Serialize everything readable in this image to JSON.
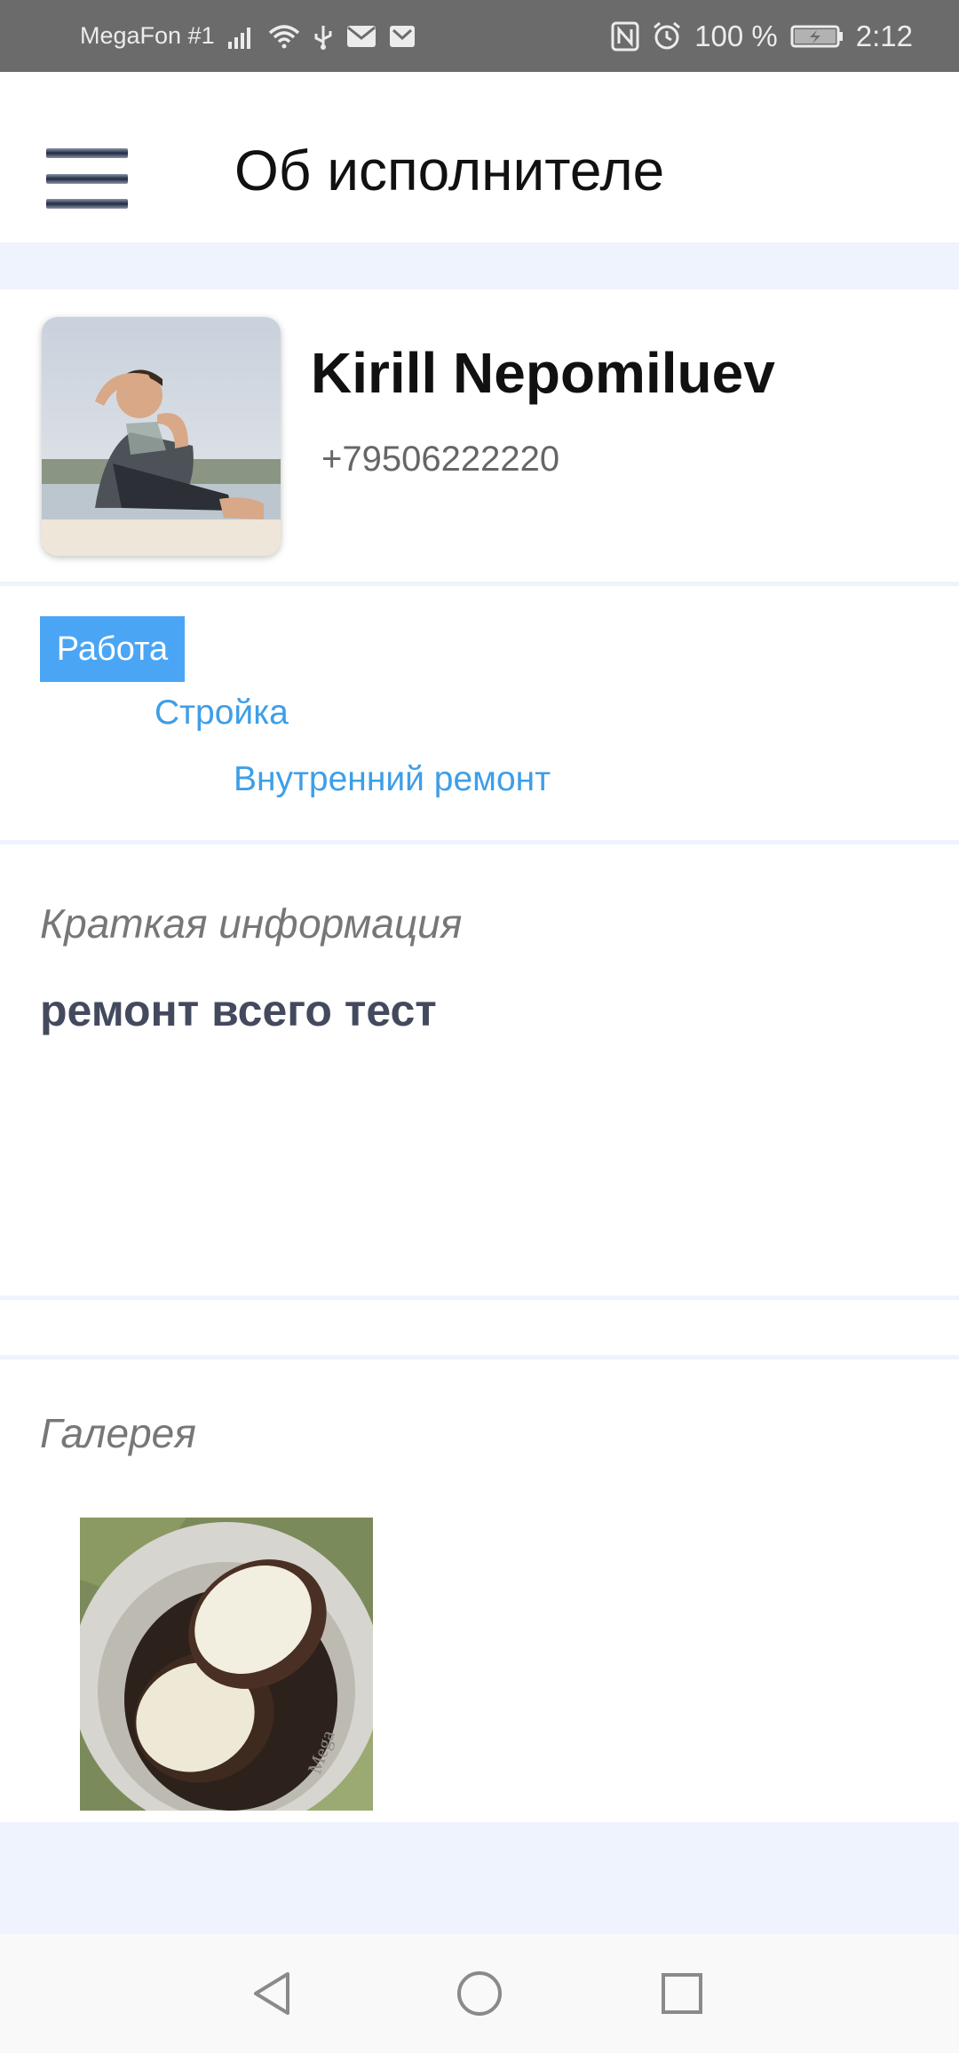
{
  "status_bar": {
    "carrier": "MegaFon #1",
    "battery_percent": "100 %",
    "time": "2:12",
    "icons": [
      "signal-icon",
      "wifi-icon",
      "usb-icon",
      "mail-icon",
      "mail-icon",
      "nfc-icon",
      "alarm-icon",
      "battery-charging-icon"
    ]
  },
  "header": {
    "title": "Об исполнителе",
    "menu_icon": "hamburger-menu-icon"
  },
  "profile": {
    "name": "Kirill Nepomiluev",
    "phone": "+79506222220",
    "avatar": "profile-photo"
  },
  "categories": {
    "main": "Работа",
    "sub": [
      "Стройка",
      "Внутренний ремонт"
    ]
  },
  "info": {
    "label": "Краткая информация",
    "text": "ремонт всего тест"
  },
  "gallery": {
    "label": "Галерея",
    "items": [
      "gallery-photo"
    ]
  },
  "nav": {
    "back_icon": "back-triangle-icon",
    "home_icon": "home-circle-icon",
    "recents_icon": "recents-square-icon"
  },
  "colors": {
    "accent": "#4aa6f5",
    "link": "#3e9ee8",
    "status_bar": "#6b6b6b",
    "band": "#eef3fe"
  }
}
